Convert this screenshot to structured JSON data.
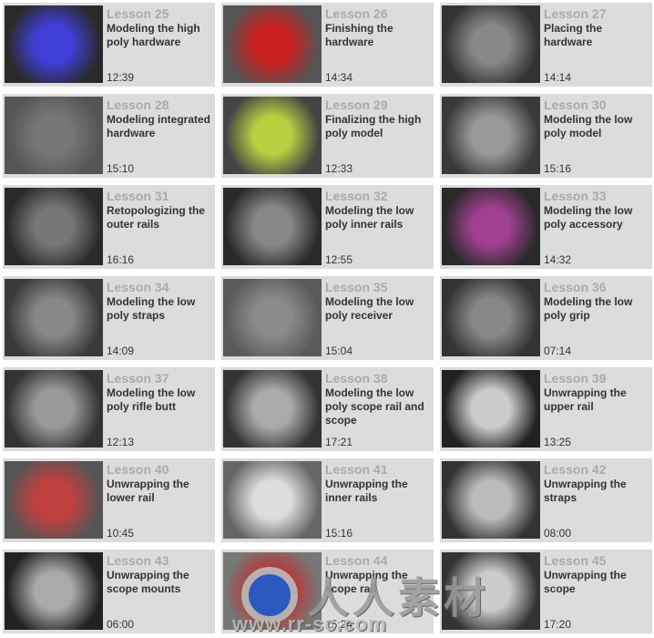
{
  "lessons": [
    {
      "label": "Lesson 25",
      "title": "Modeling the high poly hardware",
      "time": "12:39",
      "thumb": [
        "#2a2a2a",
        "#3f3fd8"
      ]
    },
    {
      "label": "Lesson 26",
      "title": "Finishing the hardware",
      "time": "14:34",
      "thumb": [
        "#555",
        "#c82020"
      ]
    },
    {
      "label": "Lesson 27",
      "title": "Placing the hardware",
      "time": "14:14",
      "thumb": [
        "#333",
        "#888"
      ]
    },
    {
      "label": "Lesson 28",
      "title": "Modeling integrated hardware",
      "time": "15:10",
      "thumb": [
        "#555",
        "#777"
      ]
    },
    {
      "label": "Lesson 29",
      "title": "Finalizing the high poly model",
      "time": "12:33",
      "thumb": [
        "#444",
        "#b8d040"
      ]
    },
    {
      "label": "Lesson 30",
      "title": "Modeling the low poly model",
      "time": "15:16",
      "thumb": [
        "#3a3a3a",
        "#999"
      ]
    },
    {
      "label": "Lesson 31",
      "title": "Retopologizing the outer rails",
      "time": "16:16",
      "thumb": [
        "#2a2a2a",
        "#777"
      ]
    },
    {
      "label": "Lesson 32",
      "title": "Modeling the low poly inner rails",
      "time": "12:55",
      "thumb": [
        "#2a2a2a",
        "#888"
      ]
    },
    {
      "label": "Lesson 33",
      "title": "Modeling the low poly accessory",
      "time": "14:32",
      "thumb": [
        "#2a2a2a",
        "#a04090"
      ]
    },
    {
      "label": "Lesson 34",
      "title": "Modeling the low poly straps",
      "time": "14:09",
      "thumb": [
        "#3a3a3a",
        "#888"
      ]
    },
    {
      "label": "Lesson 35",
      "title": "Modeling the low poly receiver",
      "time": "15:04",
      "thumb": [
        "#5a5a5a",
        "#8a8a8a"
      ]
    },
    {
      "label": "Lesson 36",
      "title": "Modeling the low poly grip",
      "time": "07:14",
      "thumb": [
        "#333",
        "#888"
      ]
    },
    {
      "label": "Lesson 37",
      "title": "Modeling the low poly rifle butt",
      "time": "12:13",
      "thumb": [
        "#333",
        "#999"
      ]
    },
    {
      "label": "Lesson 38",
      "title": "Modeling the low poly scope rail and scope",
      "time": "17:21",
      "thumb": [
        "#333",
        "#aaa"
      ]
    },
    {
      "label": "Lesson 39",
      "title": "Unwrapping the upper rail",
      "time": "13:25",
      "thumb": [
        "#222",
        "#ccc"
      ]
    },
    {
      "label": "Lesson 40",
      "title": "Unwrapping the lower rail",
      "time": "10:45",
      "thumb": [
        "#555",
        "#c04040"
      ]
    },
    {
      "label": "Lesson 41",
      "title": "Unwrapping the inner rails",
      "time": "15:16",
      "thumb": [
        "#666",
        "#ddd"
      ]
    },
    {
      "label": "Lesson 42",
      "title": "Unwrapping the straps",
      "time": "08:00",
      "thumb": [
        "#333",
        "#bbb"
      ]
    },
    {
      "label": "Lesson 43",
      "title": "Unwrapping the scope mounts",
      "time": "06:00",
      "thumb": [
        "#222",
        "#aaa"
      ]
    },
    {
      "label": "Lesson 44",
      "title": "Unwrapping the scope rail",
      "time": "15:24",
      "thumb": [
        "#777",
        "#c03030"
      ]
    },
    {
      "label": "Lesson 45",
      "title": "Unwrapping the scope",
      "time": "17:20",
      "thumb": [
        "#333",
        "#ccc"
      ]
    }
  ],
  "watermark": {
    "text": "人人素材",
    "url": "www.rr-sc.com"
  }
}
